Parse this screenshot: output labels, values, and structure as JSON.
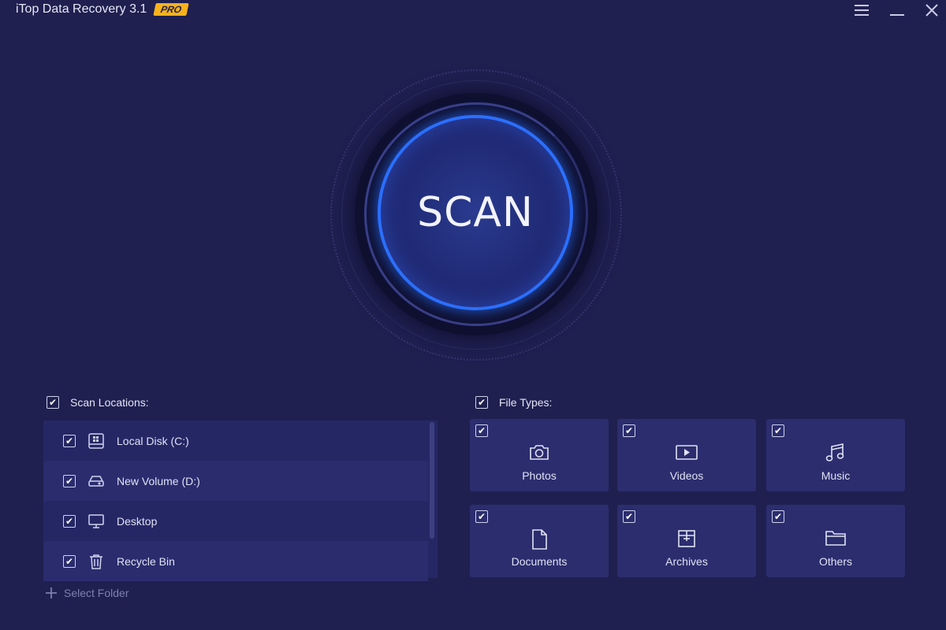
{
  "app": {
    "title": "iTop Data Recovery 3.1",
    "badge": "PRO"
  },
  "window_controls": [
    "menu-icon",
    "minimize-icon",
    "close-icon"
  ],
  "scan": {
    "label": "SCAN"
  },
  "scan_locations": {
    "header": "Scan Locations:",
    "checked": true,
    "items": [
      {
        "label": "Local Disk (C:)",
        "icon": "windows-drive-icon",
        "checked": true
      },
      {
        "label": "New Volume (D:)",
        "icon": "drive-icon",
        "checked": true
      },
      {
        "label": "Desktop",
        "icon": "monitor-icon",
        "checked": true
      },
      {
        "label": "Recycle Bin",
        "icon": "trash-icon",
        "checked": true
      }
    ],
    "select_folder": "Select Folder"
  },
  "file_types": {
    "header": "File Types:",
    "checked": true,
    "items": [
      {
        "label": "Photos",
        "icon": "camera-icon",
        "checked": true
      },
      {
        "label": "Videos",
        "icon": "video-icon",
        "checked": true
      },
      {
        "label": "Music",
        "icon": "music-icon",
        "checked": true
      },
      {
        "label": "Documents",
        "icon": "document-icon",
        "checked": true
      },
      {
        "label": "Archives",
        "icon": "archive-icon",
        "checked": true
      },
      {
        "label": "Others",
        "icon": "folder-icon",
        "checked": true
      }
    ]
  },
  "colors": {
    "background": "#1f2050",
    "accent": "#2b6fff",
    "badge": "#f5b21c"
  }
}
